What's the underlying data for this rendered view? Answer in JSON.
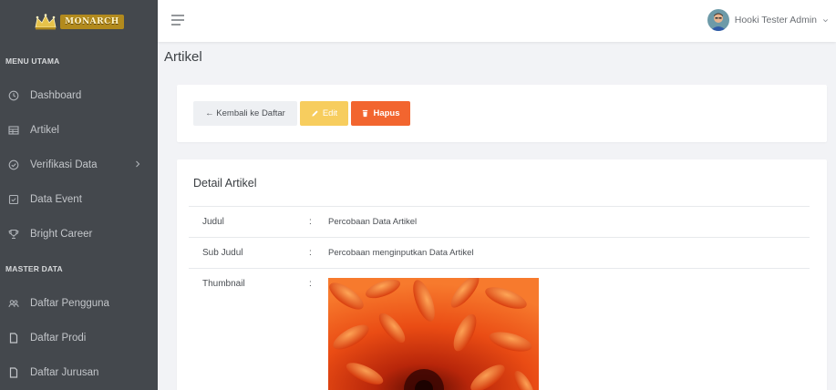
{
  "brand": {
    "name": "MONARCH"
  },
  "sidebar": {
    "sections": [
      {
        "title": "MENU UTAMA"
      },
      {
        "title": "MASTER DATA"
      }
    ],
    "items": [
      {
        "label": "Dashboard",
        "icon": "clock-icon"
      },
      {
        "label": "Artikel",
        "icon": "table-icon"
      },
      {
        "label": "Verifikasi Data",
        "icon": "check-circle-icon",
        "has_submenu": true
      },
      {
        "label": "Data Event",
        "icon": "calendar-check-icon"
      },
      {
        "label": "Bright Career",
        "icon": "trophy-icon"
      },
      {
        "label": "Daftar Pengguna",
        "icon": "users-icon"
      },
      {
        "label": "Daftar Prodi",
        "icon": "file-icon"
      },
      {
        "label": "Daftar Jurusan",
        "icon": "file-icon"
      }
    ]
  },
  "topbar": {
    "user_name": "Hooki Tester Admin"
  },
  "page": {
    "title": "Artikel"
  },
  "actions": {
    "back_label": "← Kembali ke Daftar",
    "edit_label": "Edit",
    "delete_label": "Hapus"
  },
  "detail": {
    "title": "Detail Artikel",
    "separator": ":",
    "rows": [
      {
        "label": "Judul",
        "value": "Percobaan Data Artikel"
      },
      {
        "label": "Sub Judul",
        "value": "Percobaan menginputkan Data Artikel"
      },
      {
        "label": "Thumbnail",
        "value": ""
      }
    ]
  },
  "colors": {
    "sidebar_bg": "#44484d",
    "edit_button": "#f7cd5e",
    "delete_button": "#f2652f",
    "page_bg": "#f2f3f6"
  }
}
